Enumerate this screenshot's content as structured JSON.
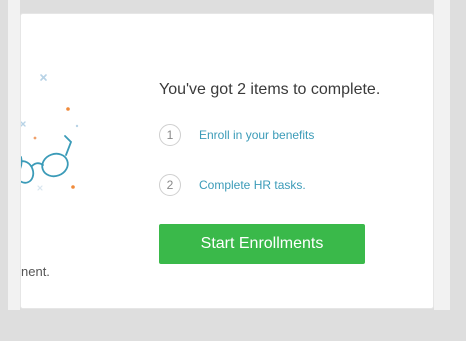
{
  "card": {
    "partial_text": "nent.",
    "headline": "You've got 2 items to complete.",
    "steps": [
      {
        "number": "1",
        "label": "Enroll in your benefits"
      },
      {
        "number": "2",
        "label": "Complete HR tasks."
      }
    ],
    "start_button_label": "Start Enrollments"
  },
  "colors": {
    "accent_green": "#3ab94a",
    "link_blue": "#3b9bb8",
    "illustration_teal": "#3b9bb8",
    "decor_orange": "#f08a3a",
    "decor_blue": "#b8d3e6"
  },
  "icons": {
    "illustration": "glasses-illustration"
  }
}
